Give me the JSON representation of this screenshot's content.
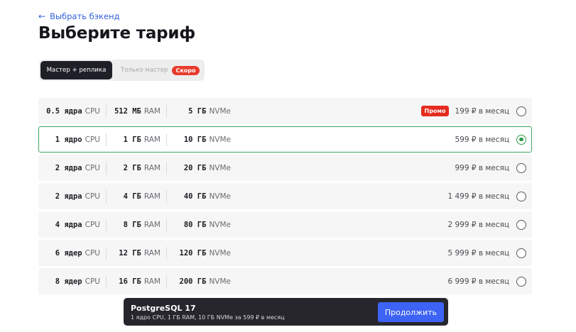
{
  "header": {
    "back_label": "Выбрать бэкенд",
    "title": "Выберите тариф"
  },
  "mode_switch": {
    "active_label": "Мастер + реплика",
    "disabled_label": "Только мастер",
    "soon_badge": "Скоро"
  },
  "plans": [
    {
      "cpu_value": "0.5 ядра",
      "cpu_unit": "CPU",
      "ram_value": "512 МБ",
      "ram_unit": "RAM",
      "disk_value": "5 ГБ",
      "disk_unit": "NVMe",
      "promo": "Промо",
      "price": "199 ₽ в месяц",
      "selected": false
    },
    {
      "cpu_value": "1 ядро",
      "cpu_unit": "CPU",
      "ram_value": "1 ГБ",
      "ram_unit": "RAM",
      "disk_value": "10 ГБ",
      "disk_unit": "NVMe",
      "promo": "",
      "price": "599 ₽ в месяц",
      "selected": true
    },
    {
      "cpu_value": "2 ядра",
      "cpu_unit": "CPU",
      "ram_value": "2 ГБ",
      "ram_unit": "RAM",
      "disk_value": "20 ГБ",
      "disk_unit": "NVMe",
      "promo": "",
      "price": "999 ₽ в месяц",
      "selected": false
    },
    {
      "cpu_value": "2 ядра",
      "cpu_unit": "CPU",
      "ram_value": "4 ГБ",
      "ram_unit": "RAM",
      "disk_value": "40 ГБ",
      "disk_unit": "NVMe",
      "promo": "",
      "price": "1 499 ₽ в месяц",
      "selected": false
    },
    {
      "cpu_value": "4 ядра",
      "cpu_unit": "CPU",
      "ram_value": "8 ГБ",
      "ram_unit": "RAM",
      "disk_value": "80 ГБ",
      "disk_unit": "NVMe",
      "promo": "",
      "price": "2 999 ₽ в месяц",
      "selected": false
    },
    {
      "cpu_value": "6 ядер",
      "cpu_unit": "CPU",
      "ram_value": "12 ГБ",
      "ram_unit": "RAM",
      "disk_value": "120 ГБ",
      "disk_unit": "NVMe",
      "promo": "",
      "price": "5 999 ₽ в месяц",
      "selected": false
    },
    {
      "cpu_value": "8 ядер",
      "cpu_unit": "CPU",
      "ram_value": "16 ГБ",
      "ram_unit": "RAM",
      "disk_value": "200 ГБ",
      "disk_unit": "NVMe",
      "promo": "",
      "price": "6 999 ₽ в месяц",
      "selected": false
    }
  ],
  "summary_bar": {
    "title": "PostgreSQL 17",
    "subtitle": "1 ядро CPU, 1 ГБ RAM, 10 ГБ NVMe за 599 ₽ в месяц",
    "continue_label": "Продолжить"
  },
  "icons": {
    "back": "arrow-left-icon"
  },
  "colors": {
    "accent_blue": "#3d63f5",
    "link_blue": "#2f5fdc",
    "selected_green": "#2e9a48",
    "promo_red": "#e52b1f",
    "dark": "#1f1f28"
  }
}
